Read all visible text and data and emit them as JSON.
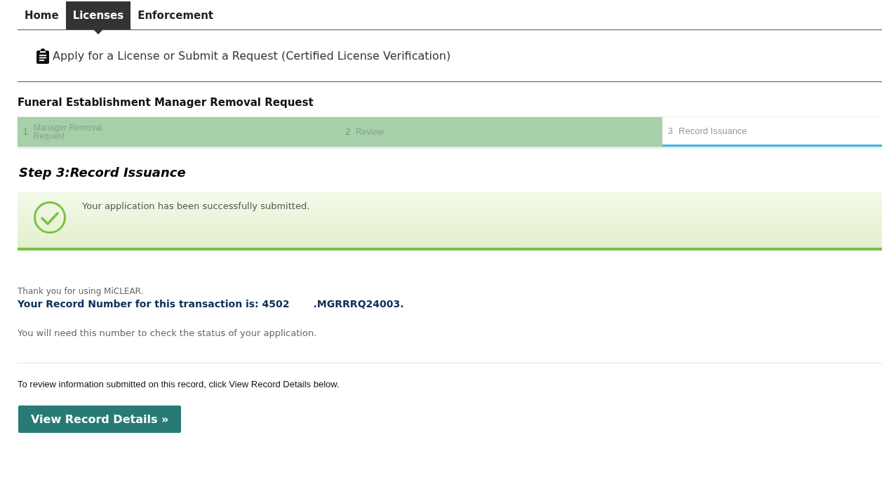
{
  "tabs": [
    {
      "label": "Home",
      "selected": false
    },
    {
      "label": "Licenses",
      "selected": true
    },
    {
      "label": "Enforcement",
      "selected": false
    }
  ],
  "action_link": "Apply for a License or Submit a Request (Certified License Verification)",
  "form_title": "Funeral Establishment Manager Removal Request",
  "steps": [
    {
      "number": "1",
      "label": "Manager Removal Request",
      "completed": true
    },
    {
      "number": "2",
      "label": "Review",
      "completed": true
    },
    {
      "number": "3",
      "label": "Record Issuance",
      "completed": false
    }
  ],
  "step_heading": "Step 3:Record Issuance",
  "success_message": "Your application has been successfully submitted.",
  "thanks": "Thank you for using MiCLEAR.",
  "record_number_prefix": "Your Record Number for this transaction is: 4502",
  "record_number_suffix": ".MGRRRQ24003.",
  "status_note": "You will need this number to check the status of your application.",
  "review_note": "To review information submitted on this record, click View Record Details below.",
  "details_button": "View Record Details »"
}
